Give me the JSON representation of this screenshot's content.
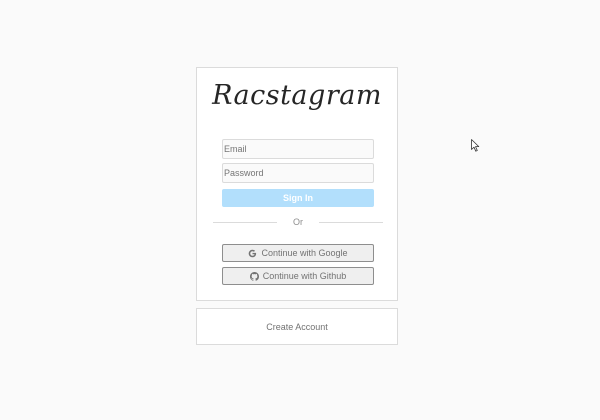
{
  "app": {
    "logo_text": "Racstagram"
  },
  "login_form": {
    "email": {
      "value": "",
      "placeholder": "Email"
    },
    "password": {
      "value": "",
      "placeholder": "Password"
    },
    "sign_in_label": "Sign In",
    "divider_text": "Or",
    "google_label": "Continue with Google",
    "github_label": "Continue with Github"
  },
  "signup": {
    "create_account_label": "Create Account"
  },
  "icons": {
    "google": "google-g-icon",
    "github": "github-octocat-icon",
    "cursor": "mouse-pointer-icon"
  },
  "colors": {
    "background": "#fafafa",
    "card_border": "#dbdbdb",
    "sign_in_button": "#b2dffc",
    "oauth_button_bg": "#efefef",
    "muted_text": "#737373"
  }
}
